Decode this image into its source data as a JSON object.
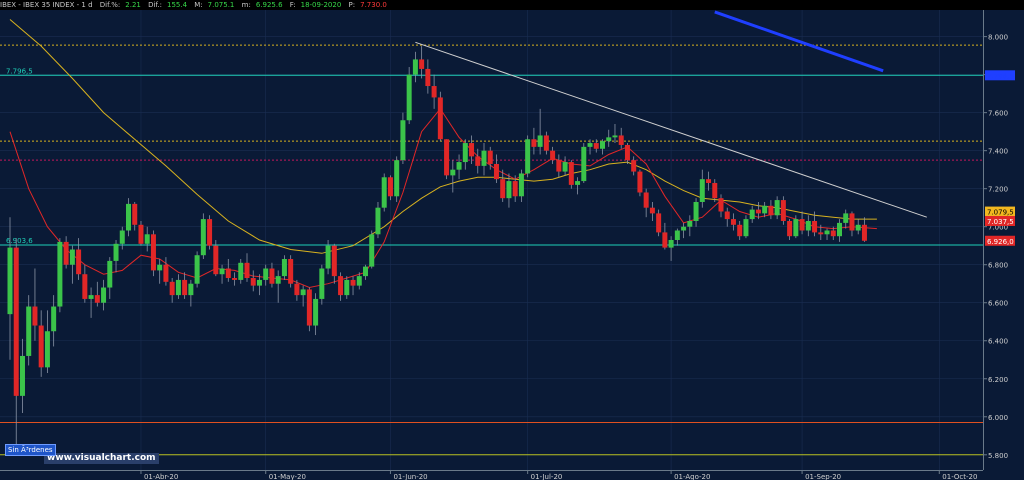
{
  "header": {
    "symbol": "IBEX - IBEX 35 INDEX - 1 d",
    "dif_pct_label": "Dif.%:",
    "dif_pct": "2.21",
    "dif_label": "Dif.:",
    "dif": "155.4",
    "max_label": "M:",
    "max": "7.075.1",
    "min_label": "m:",
    "min": "6.925.6",
    "date_label": "F:",
    "date": "18-09-2020",
    "last_label": "P:",
    "last": "7.730.0"
  },
  "watermark": "www.visualchart.com",
  "order_button": "Sin Ã³rdenes",
  "colors": {
    "background": "#0a1a36",
    "up": "#3bc44a",
    "down": "#e12727",
    "sma_fast": "#e12727",
    "sma_slow": "#d8b21f",
    "support": "#1fd0b8",
    "trendline": "#d0d0d0",
    "blue_line": "#1f3fff"
  },
  "chart_data": {
    "type": "candlestick",
    "ylim": [
      5720,
      8140
    ],
    "yticks": [
      5800,
      6000,
      6200,
      6400,
      6600,
      6800,
      7000,
      7200,
      7400,
      7600,
      7800,
      8000
    ],
    "ytick_labels": [
      "5.800",
      "6.000",
      "6.200",
      "6.400",
      "6.600",
      "6.800",
      "7.000",
      "7.200",
      "7.400",
      "7.600",
      "7.800",
      "8.000"
    ],
    "xticks": [
      {
        "label": "01-Abr-20",
        "bar": 21
      },
      {
        "label": "01-May-20",
        "bar": 41
      },
      {
        "label": "01-Jun-20",
        "bar": 61
      },
      {
        "label": "01-Jul-20",
        "bar": 83
      },
      {
        "label": "01-Ago-20",
        "bar": 106
      },
      {
        "label": "01-Sep-20",
        "bar": 127
      },
      {
        "label": "01-Oct-20",
        "bar": 149
      }
    ],
    "xrange": [
      0,
      155
    ],
    "candles": [
      [
        6540,
        7050,
        6300,
        6890
      ],
      [
        6890,
        6940,
        5810,
        6110
      ],
      [
        6110,
        6410,
        6020,
        6320
      ],
      [
        6320,
        6640,
        6270,
        6580
      ],
      [
        6580,
        6780,
        6400,
        6480
      ],
      [
        6480,
        6560,
        6210,
        6260
      ],
      [
        6260,
        6560,
        6230,
        6450
      ],
      [
        6450,
        6640,
        6370,
        6580
      ],
      [
        6580,
        6940,
        6550,
        6920
      ],
      [
        6920,
        6950,
        6780,
        6800
      ],
      [
        6800,
        6900,
        6700,
        6880
      ],
      [
        6880,
        6940,
        6720,
        6750
      ],
      [
        6750,
        6800,
        6600,
        6620
      ],
      [
        6620,
        6680,
        6520,
        6640
      ],
      [
        6640,
        6710,
        6580,
        6600
      ],
      [
        6600,
        6720,
        6560,
        6680
      ],
      [
        6680,
        6840,
        6620,
        6820
      ],
      [
        6820,
        6930,
        6760,
        6910
      ],
      [
        6910,
        7000,
        6880,
        6980
      ],
      [
        6980,
        7150,
        6950,
        7120
      ],
      [
        7120,
        7130,
        6980,
        7010
      ],
      [
        7010,
        7030,
        6900,
        6910
      ],
      [
        6910,
        7000,
        6870,
        6960
      ],
      [
        6960,
        6980,
        6740,
        6770
      ],
      [
        6770,
        6830,
        6700,
        6800
      ],
      [
        6800,
        6840,
        6690,
        6710
      ],
      [
        6710,
        6730,
        6600,
        6640
      ],
      [
        6640,
        6750,
        6620,
        6720
      ],
      [
        6720,
        6760,
        6620,
        6640
      ],
      [
        6640,
        6720,
        6580,
        6700
      ],
      [
        6700,
        6870,
        6680,
        6850
      ],
      [
        6850,
        7070,
        6830,
        7040
      ],
      [
        7040,
        7060,
        6880,
        6900
      ],
      [
        6900,
        6930,
        6740,
        6750
      ],
      [
        6750,
        6800,
        6700,
        6780
      ],
      [
        6780,
        6830,
        6710,
        6730
      ],
      [
        6730,
        6760,
        6690,
        6720
      ],
      [
        6720,
        6830,
        6700,
        6810
      ],
      [
        6810,
        6860,
        6710,
        6730
      ],
      [
        6730,
        6770,
        6660,
        6690
      ],
      [
        6690,
        6750,
        6640,
        6720
      ],
      [
        6720,
        6800,
        6690,
        6780
      ],
      [
        6780,
        6810,
        6680,
        6700
      ],
      [
        6700,
        6770,
        6600,
        6740
      ],
      [
        6740,
        6850,
        6720,
        6830
      ],
      [
        6830,
        6850,
        6680,
        6700
      ],
      [
        6700,
        6720,
        6610,
        6640
      ],
      [
        6640,
        6690,
        6580,
        6670
      ],
      [
        6670,
        6680,
        6450,
        6480
      ],
      [
        6480,
        6650,
        6430,
        6620
      ],
      [
        6620,
        6800,
        6590,
        6780
      ],
      [
        6780,
        6930,
        6750,
        6900
      ],
      [
        6900,
        6910,
        6700,
        6740
      ],
      [
        6740,
        6760,
        6610,
        6640
      ],
      [
        6640,
        6740,
        6620,
        6720
      ],
      [
        6720,
        6740,
        6640,
        6690
      ],
      [
        6690,
        6760,
        6670,
        6740
      ],
      [
        6740,
        6800,
        6720,
        6790
      ],
      [
        6790,
        6980,
        6780,
        6960
      ],
      [
        6960,
        7130,
        6940,
        7100
      ],
      [
        7100,
        7280,
        7080,
        7260
      ],
      [
        7260,
        7270,
        7140,
        7160
      ],
      [
        7160,
        7370,
        7130,
        7350
      ],
      [
        7350,
        7600,
        7330,
        7560
      ],
      [
        7560,
        7840,
        7540,
        7800
      ],
      [
        7800,
        7920,
        7760,
        7880
      ],
      [
        7880,
        7950,
        7780,
        7830
      ],
      [
        7830,
        7880,
        7700,
        7740
      ],
      [
        7740,
        7800,
        7620,
        7680
      ],
      [
        7680,
        7710,
        7450,
        7460
      ],
      [
        7460,
        7460,
        7250,
        7270
      ],
      [
        7270,
        7350,
        7180,
        7300
      ],
      [
        7300,
        7380,
        7250,
        7340
      ],
      [
        7340,
        7460,
        7300,
        7440
      ],
      [
        7440,
        7480,
        7330,
        7370
      ],
      [
        7370,
        7410,
        7280,
        7320
      ],
      [
        7320,
        7440,
        7270,
        7400
      ],
      [
        7400,
        7420,
        7300,
        7330
      ],
      [
        7330,
        7380,
        7230,
        7250
      ],
      [
        7250,
        7300,
        7130,
        7150
      ],
      [
        7150,
        7280,
        7100,
        7240
      ],
      [
        7240,
        7270,
        7130,
        7160
      ],
      [
        7160,
        7300,
        7130,
        7280
      ],
      [
        7280,
        7480,
        7260,
        7460
      ],
      [
        7460,
        7520,
        7380,
        7420
      ],
      [
        7420,
        7620,
        7380,
        7480
      ],
      [
        7480,
        7500,
        7380,
        7400
      ],
      [
        7400,
        7420,
        7330,
        7350
      ],
      [
        7350,
        7380,
        7260,
        7290
      ],
      [
        7290,
        7370,
        7270,
        7340
      ],
      [
        7340,
        7350,
        7200,
        7220
      ],
      [
        7220,
        7260,
        7170,
        7240
      ],
      [
        7240,
        7440,
        7230,
        7420
      ],
      [
        7420,
        7460,
        7380,
        7440
      ],
      [
        7440,
        7460,
        7390,
        7410
      ],
      [
        7410,
        7460,
        7380,
        7450
      ],
      [
        7450,
        7510,
        7420,
        7470
      ],
      [
        7470,
        7540,
        7440,
        7480
      ],
      [
        7480,
        7520,
        7410,
        7430
      ],
      [
        7430,
        7440,
        7330,
        7350
      ],
      [
        7350,
        7370,
        7270,
        7290
      ],
      [
        7290,
        7300,
        7160,
        7180
      ],
      [
        7180,
        7200,
        7050,
        7100
      ],
      [
        7100,
        7130,
        7030,
        7070
      ],
      [
        7070,
        7090,
        6950,
        6970
      ],
      [
        6970,
        7020,
        6880,
        6890
      ],
      [
        6890,
        6950,
        6820,
        6930
      ],
      [
        6930,
        6990,
        6900,
        6980
      ],
      [
        6980,
        7020,
        6940,
        7000
      ],
      [
        7000,
        7060,
        6950,
        7030
      ],
      [
        7030,
        7150,
        7000,
        7130
      ],
      [
        7130,
        7300,
        7100,
        7250
      ],
      [
        7250,
        7290,
        7190,
        7230
      ],
      [
        7230,
        7250,
        7130,
        7150
      ],
      [
        7150,
        7170,
        7050,
        7080
      ],
      [
        7080,
        7100,
        7000,
        7040
      ],
      [
        7040,
        7070,
        6980,
        7010
      ],
      [
        7010,
        7030,
        6930,
        6950
      ],
      [
        6950,
        7060,
        6940,
        7040
      ],
      [
        7040,
        7110,
        7020,
        7090
      ],
      [
        7090,
        7130,
        7040,
        7070
      ],
      [
        7070,
        7130,
        7050,
        7110
      ],
      [
        7110,
        7140,
        7040,
        7060
      ],
      [
        7060,
        7160,
        7040,
        7140
      ],
      [
        7140,
        7160,
        7010,
        7030
      ],
      [
        7030,
        7040,
        6930,
        6950
      ],
      [
        6950,
        7060,
        6940,
        7040
      ],
      [
        7040,
        7080,
        6960,
        6980
      ],
      [
        6980,
        7060,
        6950,
        7030
      ],
      [
        7030,
        7080,
        6950,
        6970
      ],
      [
        6970,
        7010,
        6930,
        6960
      ],
      [
        6960,
        6990,
        6930,
        6980
      ],
      [
        6980,
        7000,
        6930,
        6950
      ],
      [
        6950,
        7040,
        6920,
        7020
      ],
      [
        7020,
        7090,
        6990,
        7070
      ],
      [
        7070,
        7080,
        6950,
        6980
      ],
      [
        6980,
        7040,
        6960,
        7010
      ],
      [
        7010,
        7050,
        6920,
        6926
      ]
    ],
    "sma_fast": [
      [
        0,
        7500
      ],
      [
        3,
        7200
      ],
      [
        6,
        7000
      ],
      [
        9,
        6880
      ],
      [
        12,
        6800
      ],
      [
        15,
        6750
      ],
      [
        18,
        6770
      ],
      [
        21,
        6850
      ],
      [
        24,
        6830
      ],
      [
        27,
        6760
      ],
      [
        30,
        6730
      ],
      [
        33,
        6780
      ],
      [
        36,
        6770
      ],
      [
        39,
        6740
      ],
      [
        42,
        6730
      ],
      [
        45,
        6720
      ],
      [
        48,
        6680
      ],
      [
        51,
        6700
      ],
      [
        54,
        6730
      ],
      [
        57,
        6760
      ],
      [
        60,
        6920
      ],
      [
        63,
        7180
      ],
      [
        66,
        7500
      ],
      [
        69,
        7620
      ],
      [
        72,
        7470
      ],
      [
        75,
        7370
      ],
      [
        78,
        7300
      ],
      [
        81,
        7250
      ],
      [
        84,
        7300
      ],
      [
        87,
        7360
      ],
      [
        90,
        7330
      ],
      [
        93,
        7320
      ],
      [
        96,
        7380
      ],
      [
        99,
        7420
      ],
      [
        102,
        7330
      ],
      [
        105,
        7160
      ],
      [
        108,
        7020
      ],
      [
        111,
        7050
      ],
      [
        114,
        7140
      ],
      [
        117,
        7080
      ],
      [
        120,
        7050
      ],
      [
        123,
        7070
      ],
      [
        126,
        7040
      ],
      [
        129,
        7000
      ],
      [
        132,
        6990
      ],
      [
        135,
        7000
      ],
      [
        139,
        6990
      ]
    ],
    "sma_slow": [
      [
        0,
        8090
      ],
      [
        5,
        7950
      ],
      [
        10,
        7780
      ],
      [
        15,
        7600
      ],
      [
        20,
        7460
      ],
      [
        25,
        7320
      ],
      [
        30,
        7170
      ],
      [
        35,
        7030
      ],
      [
        40,
        6930
      ],
      [
        45,
        6880
      ],
      [
        50,
        6860
      ],
      [
        55,
        6900
      ],
      [
        60,
        7000
      ],
      [
        63,
        7080
      ],
      [
        66,
        7150
      ],
      [
        69,
        7210
      ],
      [
        72,
        7240
      ],
      [
        75,
        7260
      ],
      [
        78,
        7260
      ],
      [
        81,
        7250
      ],
      [
        84,
        7240
      ],
      [
        87,
        7250
      ],
      [
        90,
        7280
      ],
      [
        93,
        7300
      ],
      [
        96,
        7330
      ],
      [
        99,
        7340
      ],
      [
        102,
        7300
      ],
      [
        105,
        7240
      ],
      [
        108,
        7190
      ],
      [
        111,
        7150
      ],
      [
        114,
        7140
      ],
      [
        117,
        7130
      ],
      [
        120,
        7110
      ],
      [
        123,
        7100
      ],
      [
        126,
        7080
      ],
      [
        129,
        7060
      ],
      [
        132,
        7050
      ],
      [
        135,
        7040
      ],
      [
        139,
        7040
      ]
    ],
    "hlines": [
      {
        "y": 7796.5,
        "color": "#1fd0b8",
        "dash": false,
        "label": "7.796,5"
      },
      {
        "y": 6903.6,
        "color": "#1fd0b8",
        "dash": false,
        "label": "6.903,6"
      },
      {
        "y": 7955,
        "color": "#d8b21f",
        "dash": true,
        "label": ""
      },
      {
        "y": 7450,
        "color": "#d8b21f",
        "dash": true,
        "label": ""
      },
      {
        "y": 7350,
        "color": "#c2185b",
        "dash": true,
        "label": ""
      },
      {
        "y": 5970,
        "color": "#e05020",
        "dash": false,
        "label": ""
      },
      {
        "y": 5800,
        "color": "#b8c020",
        "dash": false,
        "label": ""
      }
    ],
    "trendlines": [
      {
        "from": [
          65,
          7970
        ],
        "to": [
          147,
          7050
        ],
        "color": "#d0d0d0"
      },
      {
        "from": [
          113,
          8130
        ],
        "to": [
          140,
          7820
        ],
        "color": "#1f3fff"
      }
    ],
    "price_tags": [
      {
        "text": "7.796,5",
        "y": 7796.5,
        "bg": "#1f3fff",
        "fg": "#1f3fff"
      },
      {
        "text": "7.079,5",
        "y": 7079.5,
        "bg": "#f2b820",
        "fg": "#000000"
      },
      {
        "text": "7.037,5",
        "y": 7030,
        "bg": "#e12727",
        "fg": "#ffffff"
      },
      {
        "text": "6.926,0",
        "y": 6926,
        "bg": "#e12727",
        "fg": "#ffffff"
      }
    ]
  }
}
